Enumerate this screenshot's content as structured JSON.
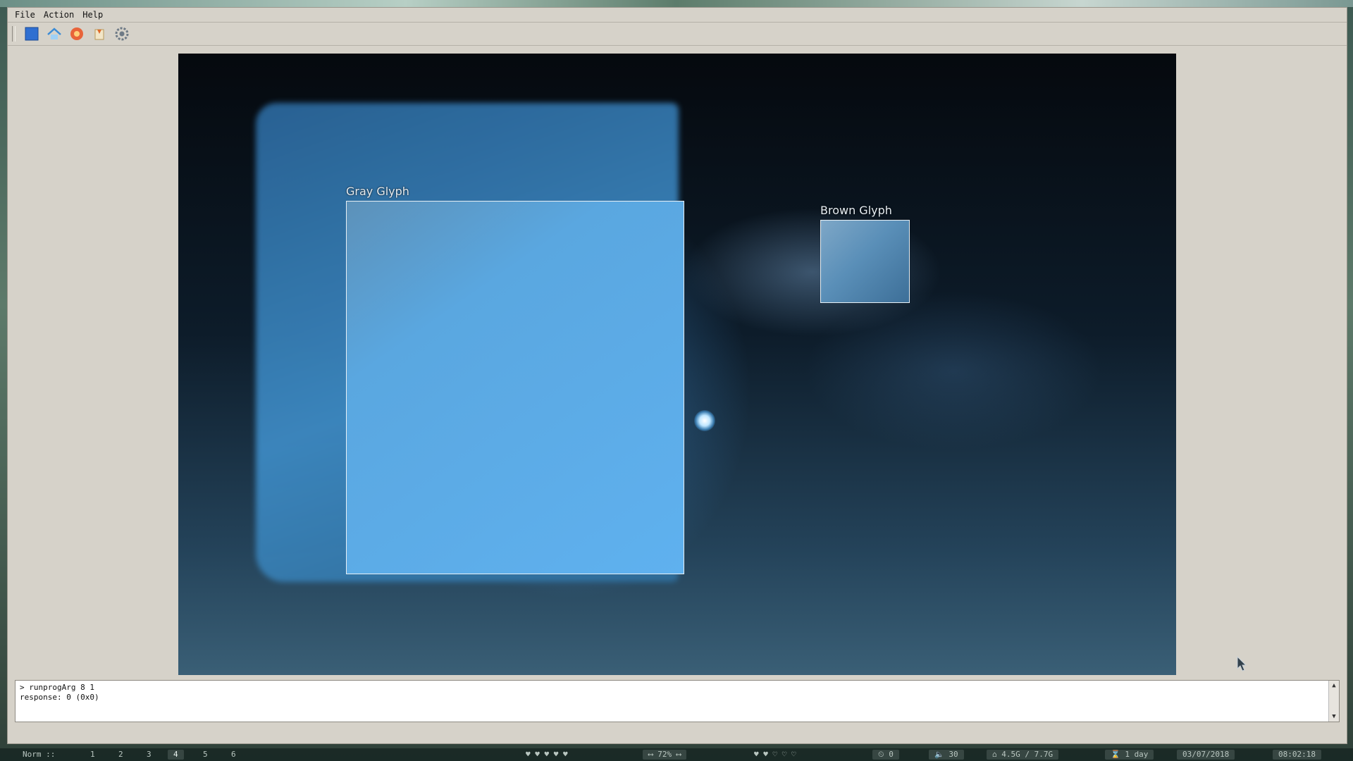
{
  "menu": {
    "file": "File",
    "action": "Action",
    "help": "Help"
  },
  "toolbar": {
    "buttons": [
      "blue-square-icon",
      "home-icon",
      "orange-burst-icon",
      "badge-icon",
      "settings-gear-icon"
    ]
  },
  "viewer": {
    "detections": [
      {
        "label": "Gray Glyph"
      },
      {
        "label": "Brown Glyph"
      }
    ]
  },
  "console": {
    "line1": "> runprogArg 8 1",
    "line2": "response: 0 (0x0)"
  },
  "statusbar": {
    "mode": "Norm ::",
    "workspaces": [
      "1",
      "2",
      "3",
      "4",
      "5",
      "6"
    ],
    "active_workspace": "4",
    "hearts": "♥ ♥ ♥ ♥ ♥",
    "width_indicator": "⟷ 72% ⟷",
    "hearts2": "♥ ♥ ♡ ♡ ♡",
    "timer": "⏲ 0",
    "volume": "🔈 30",
    "memory": "⌂ 4.5G / 7.7G",
    "uptime": "⌛ 1 day",
    "date": "03/07/2018",
    "time": "08:02:18"
  },
  "colors": {
    "window_bg": "#d6d2c9",
    "detection_border": "#e8f0f5",
    "accent_blue": "#5fb1ef"
  }
}
